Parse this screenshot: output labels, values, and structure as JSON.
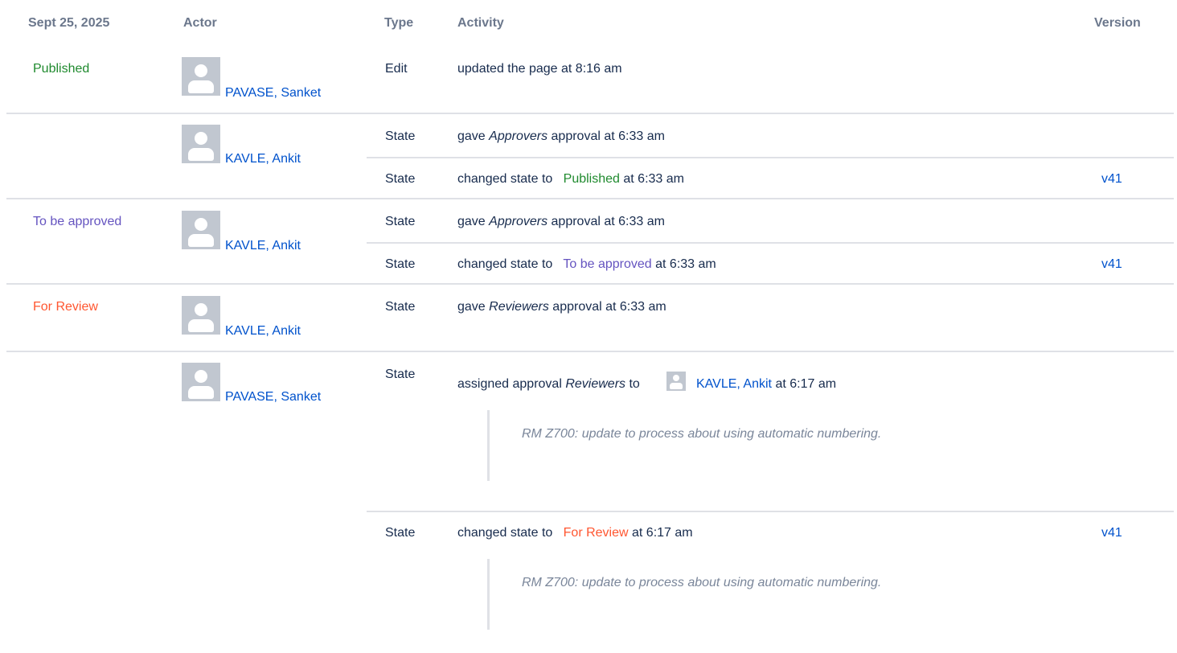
{
  "header": {
    "date": "Sept 25, 2025",
    "actor": "Actor",
    "type": "Type",
    "activity": "Activity",
    "version": "Version"
  },
  "status": {
    "published": "Published",
    "to_be_approved": "To be approved",
    "for_review": "For Review"
  },
  "actors": {
    "pavase": "PAVASE, Sanket",
    "kavle": "KAVLE, Ankit"
  },
  "types": {
    "edit": "Edit",
    "state": "State"
  },
  "activity": {
    "updated": "updated the page at 8:16 am",
    "gave": "gave",
    "approvers": "Approvers",
    "reviewers": "Reviewers",
    "approval_at_633": "approval at 6:33 am",
    "changed_state_to": "changed state to",
    "at_633": "at 6:33 am",
    "at_617": "at 6:17 am",
    "assigned_approval": "assigned approval",
    "to": "to"
  },
  "version": "v41",
  "comment": "RM Z700: update to process about using automatic numbering.",
  "colors": {
    "published": "#1f8a2e",
    "to_be_approved": "#6554c0",
    "for_review": "#ff5630",
    "link": "#0052cc"
  },
  "icons": {
    "avatar": "default-user-avatar-icon"
  }
}
